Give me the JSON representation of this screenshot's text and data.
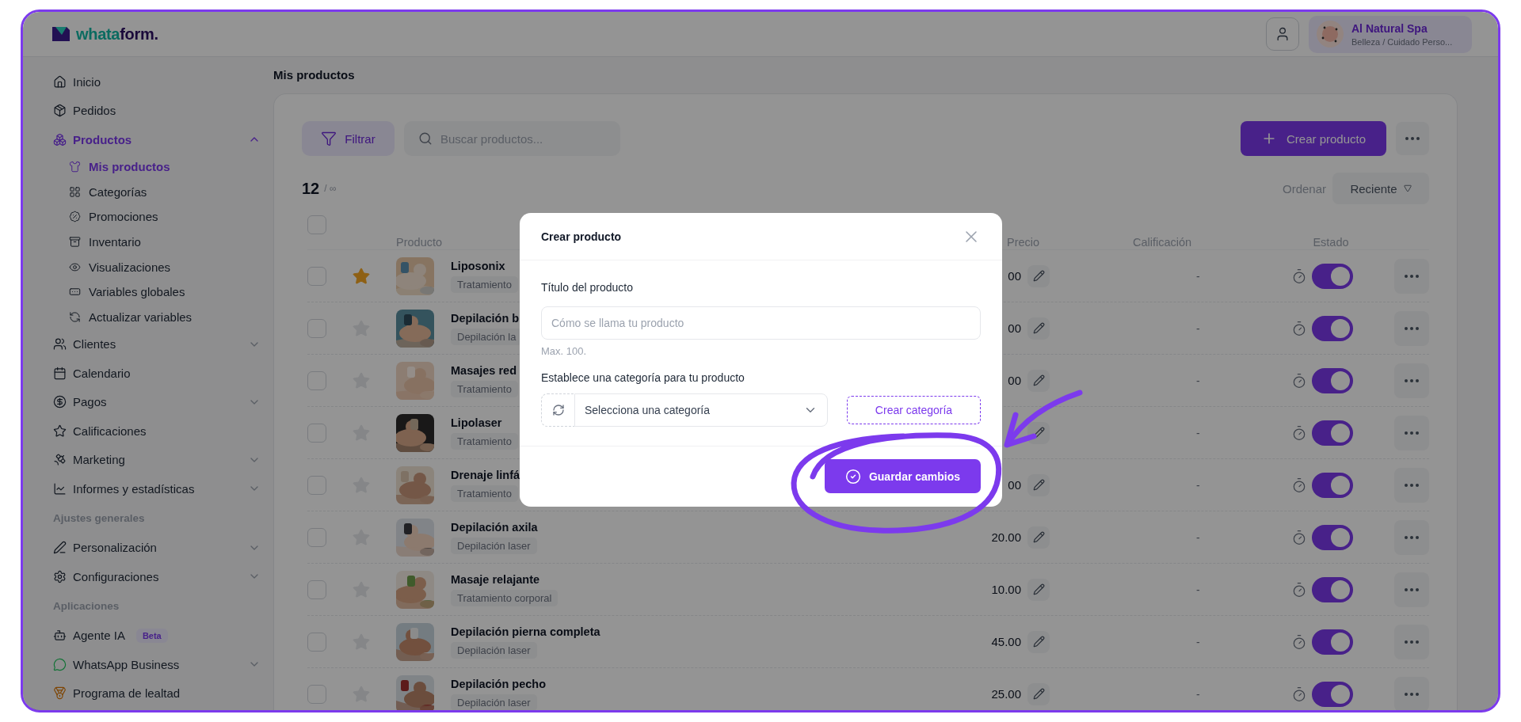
{
  "header": {
    "logo": [
      "whata",
      "form."
    ],
    "business": {
      "name": "Al Natural Spa",
      "category": "Belleza / Cuidado Perso..."
    }
  },
  "sidebar": {
    "items": [
      {
        "kind": "item",
        "label": "Inicio",
        "selected": false
      },
      {
        "kind": "item",
        "label": "Pedidos",
        "selected": false
      },
      {
        "kind": "item",
        "label": "Productos",
        "selected": true,
        "expanded": true,
        "children": [
          {
            "label": "Mis productos",
            "selected": true
          },
          {
            "label": "Categorías",
            "selected": false
          },
          {
            "label": "Promociones",
            "selected": false
          },
          {
            "label": "Inventario",
            "selected": false
          },
          {
            "label": "Visualizaciones",
            "selected": false
          },
          {
            "label": "Variables globales",
            "selected": false
          },
          {
            "label": "Actualizar variables",
            "selected": false
          }
        ]
      },
      {
        "kind": "item",
        "label": "Clientes",
        "selected": false,
        "expanded": false
      },
      {
        "kind": "item",
        "label": "Calendario",
        "selected": false
      },
      {
        "kind": "item",
        "label": "Pagos",
        "selected": false,
        "expanded": false
      },
      {
        "kind": "item",
        "label": "Calificaciones",
        "selected": false
      },
      {
        "kind": "item",
        "label": "Marketing",
        "selected": false,
        "expanded": false
      },
      {
        "kind": "item",
        "label": "Informes y estadísticas",
        "selected": false,
        "expanded": false
      },
      {
        "kind": "heading",
        "label": "Ajustes generales"
      },
      {
        "kind": "item",
        "label": "Personalización",
        "selected": false,
        "expanded": false
      },
      {
        "kind": "item",
        "label": "Configuraciones",
        "selected": false,
        "expanded": false
      },
      {
        "kind": "heading",
        "label": "Aplicaciones"
      },
      {
        "kind": "item",
        "label": "Agente IA",
        "selected": false,
        "badge": "Beta"
      },
      {
        "kind": "item",
        "label": "WhatsApp Business",
        "selected": false,
        "expanded": false
      },
      {
        "kind": "item",
        "label": "Programa de lealtad",
        "selected": false
      }
    ]
  },
  "page_title": "Mis productos",
  "toolbar": {
    "filter_button": "Filtrar",
    "search": {
      "placeholder": "Buscar productos..."
    },
    "create_button": "Crear producto"
  },
  "count": {
    "value": "12",
    "limit": "/ ∞"
  },
  "sort": {
    "label": "Ordenar",
    "value": "Reciente"
  },
  "table": {
    "select_all": {
      "checked": false
    },
    "columns": [
      "Producto",
      "Precio",
      "Calificación",
      "Estado"
    ],
    "rows": [
      {
        "checked": false,
        "favorite": true,
        "name": "Liposonix",
        "category": "Tratamiento",
        "price": "00",
        "rating": "-",
        "active": true
      },
      {
        "checked": false,
        "favorite": false,
        "name": "Depilación b",
        "category": "Depilación la",
        "price": "00",
        "rating": "-",
        "active": true
      },
      {
        "checked": false,
        "favorite": false,
        "name": "Masajes red",
        "category": "Tratamiento",
        "price": "00",
        "rating": "-",
        "active": true
      },
      {
        "checked": false,
        "favorite": false,
        "name": "Lipolaser",
        "category": "Tratamiento",
        "rating": "-",
        "active": true
      },
      {
        "checked": false,
        "favorite": false,
        "name": "Drenaje linfá",
        "category": "Tratamiento",
        "price": "00",
        "rating": "-",
        "active": true
      },
      {
        "checked": false,
        "favorite": false,
        "name": "Depilación axila",
        "category": "Depilación laser",
        "price": "20.00",
        "rating": "-",
        "active": true
      },
      {
        "checked": false,
        "favorite": false,
        "name": "Masaje relajante",
        "category": "Tratamiento corporal",
        "price": "10.00",
        "rating": "-",
        "active": true
      },
      {
        "checked": false,
        "favorite": false,
        "name": "Depilación pierna completa",
        "category": "Depilación laser",
        "price": "45.00",
        "rating": "-",
        "active": true
      },
      {
        "checked": false,
        "favorite": false,
        "name": "Depilación pecho",
        "category": "Depilación laser",
        "price": "25.00",
        "rating": "-",
        "active": true
      }
    ]
  },
  "modal": {
    "title": "Crear producto",
    "title_field": {
      "label": "Título del producto",
      "placeholder": "Cómo se llama tu producto",
      "hint": "Max. 100."
    },
    "category_field": {
      "label": "Establece una categoría para tu producto",
      "placeholder": "Selecciona una categoría",
      "create_button": "Crear categoría"
    },
    "save_button": "Guardar cambios"
  }
}
